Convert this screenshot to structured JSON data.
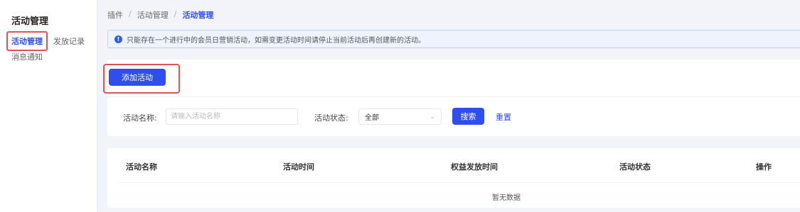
{
  "sidebar": {
    "title": "活动管理",
    "items": [
      {
        "label": "活动管理",
        "active": true
      },
      {
        "label": "发放记录"
      },
      {
        "label": "消息通知"
      }
    ]
  },
  "breadcrumb": [
    "插件",
    "活动管理",
    "活动管理"
  ],
  "alert": {
    "icon": "info-icon",
    "text": "只能存在一个进行中的会员日营销活动，如需变更活动时间请停止当前活动后再创建新的活动。"
  },
  "toolbar": {
    "add_label": "添加活动"
  },
  "filters": {
    "name_label": "活动名称:",
    "name_placeholder": "请输入活动名称",
    "status_label": "活动状态:",
    "status_value": "全部",
    "search_label": "搜索",
    "reset_label": "重置"
  },
  "table": {
    "columns": [
      "活动名称",
      "活动时间",
      "权益发放时间",
      "活动状态",
      "操作"
    ],
    "empty_text": "暂无数据"
  },
  "colors": {
    "accent": "#2f4ef0",
    "highlight": "#e05454"
  }
}
